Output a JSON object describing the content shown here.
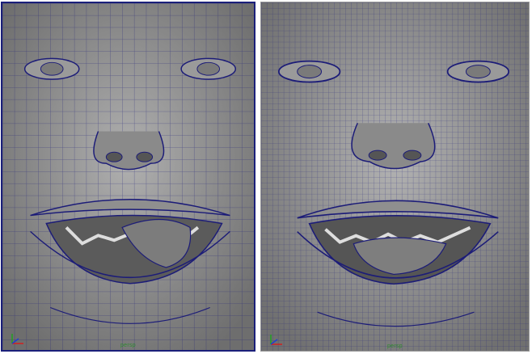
{
  "viewports": [
    {
      "camera_label": "persp",
      "mesh_density": "low",
      "selected": true
    },
    {
      "camera_label": "persp",
      "mesh_density": "high",
      "selected": false
    }
  ],
  "colors": {
    "wire": "#1c1c78",
    "skin": "#8e8e8e",
    "active_border": "#1a1f7a",
    "axis_x": "#d02020",
    "axis_y": "#20a020",
    "axis_z": "#2040d0",
    "camera_label": "#2e8b2e"
  },
  "icons": {
    "axis": "xyz-axis-icon"
  }
}
